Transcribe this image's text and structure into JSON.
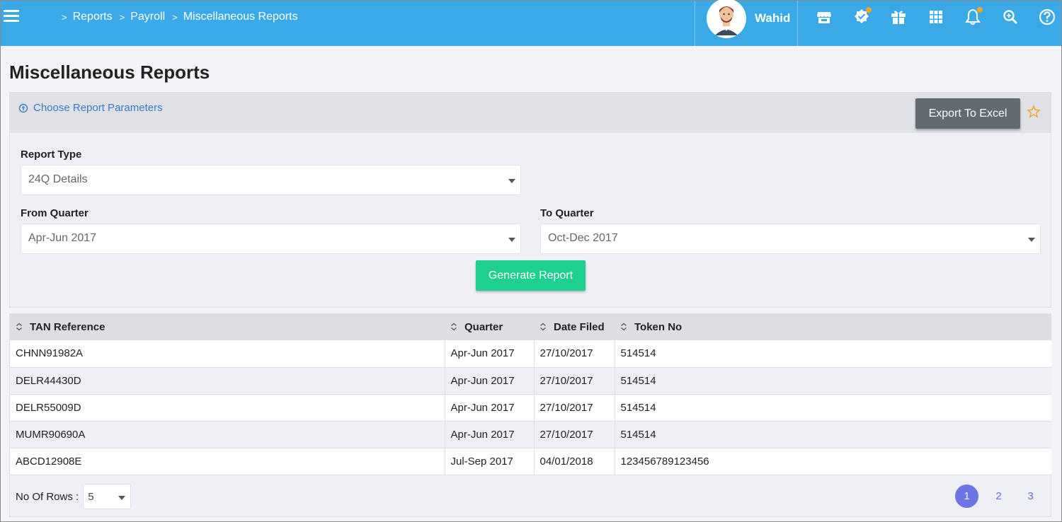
{
  "header": {
    "breadcrumb": [
      "Reports",
      "Payroll",
      "Miscellaneous Reports"
    ],
    "username": "Wahid",
    "icons": [
      "store-icon",
      "verified-badge-icon",
      "gift-icon",
      "apps-grid-icon",
      "bell-icon",
      "search-zoom-icon",
      "help-icon"
    ],
    "accent_color": "#3aa9e8"
  },
  "page": {
    "title": "Miscellaneous Reports"
  },
  "params": {
    "choose_label": "Choose Report Parameters",
    "export_label": "Export To Excel",
    "report_type_label": "Report Type",
    "report_type_value": "24Q Details",
    "from_quarter_label": "From Quarter",
    "from_quarter_value": "Apr-Jun 2017",
    "to_quarter_label": "To Quarter",
    "to_quarter_value": "Oct-Dec 2017",
    "generate_label": "Generate Report"
  },
  "table": {
    "columns": [
      "TAN Reference",
      "Quarter",
      "Date Filed",
      "Token No"
    ],
    "rows": [
      [
        "CHNN91982A",
        "Apr-Jun 2017",
        "27/10/2017",
        "514514"
      ],
      [
        "DELR44430D",
        "Apr-Jun 2017",
        "27/10/2017",
        "514514"
      ],
      [
        "DELR55009D",
        "Apr-Jun 2017",
        "27/10/2017",
        "514514"
      ],
      [
        "MUMR90690A",
        "Apr-Jun 2017",
        "27/10/2017",
        "514514"
      ],
      [
        "ABCD12908E",
        "Jul-Sep 2017",
        "04/01/2018",
        "123456789123456"
      ]
    ]
  },
  "footer": {
    "rows_label": "No Of Rows :",
    "rows_value": "5",
    "pages": [
      "1",
      "2",
      "3"
    ],
    "active_page": "1"
  }
}
